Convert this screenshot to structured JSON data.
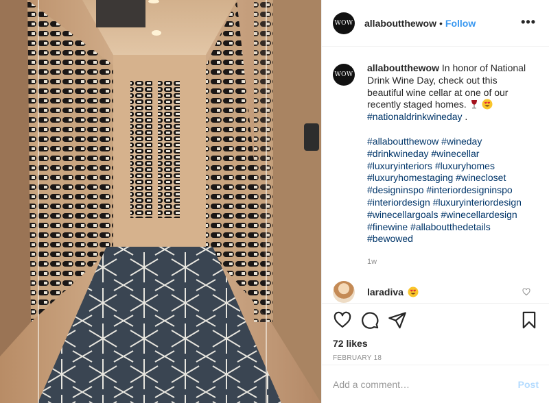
{
  "post": {
    "username": "allaboutthewow",
    "separator": "•",
    "follow_label": "Follow",
    "more_label": "•••",
    "avatar_text": "WOW",
    "caption": {
      "username": "allaboutthewow",
      "text": "In honor of National Drink Wine Day, check out this beautiful wine cellar at one of our recently staged homes.",
      "inline_hashtag": "#nationaldrinkwineday",
      "trailing": " .",
      "hashtags": [
        "#allaboutthewow #wineday",
        "#drinkwineday #winecellar",
        "#luxuryinteriors #luxuryhomes",
        "#luxuryhomestaging #winecloset",
        "#designinspo #interiordesigninspo",
        "#interiordesign #luxuryinteriordesign",
        "#winecellargoals #winecellardesign",
        "#finewine #allaboutthedetails",
        "#bewowed"
      ],
      "time": "1w"
    },
    "comment": {
      "username": "laradiva",
      "emoji": "heart-eyes-emoji"
    },
    "likes": "72 likes",
    "date": "FEBRUARY 18",
    "add_comment_placeholder": "Add a comment…",
    "post_label": "Post"
  },
  "icons": {
    "caption_emojis": [
      "wine-glass-emoji",
      "heart-eyes-emoji"
    ],
    "actions": [
      "heart-icon",
      "comment-icon",
      "share-icon",
      "bookmark-icon"
    ]
  },
  "colors": {
    "link_blue": "#3897f0",
    "hashtag_blue": "#003569",
    "muted_gray": "#8e8e8e",
    "post_disabled": "#b3dbff",
    "border": "#efefef"
  }
}
